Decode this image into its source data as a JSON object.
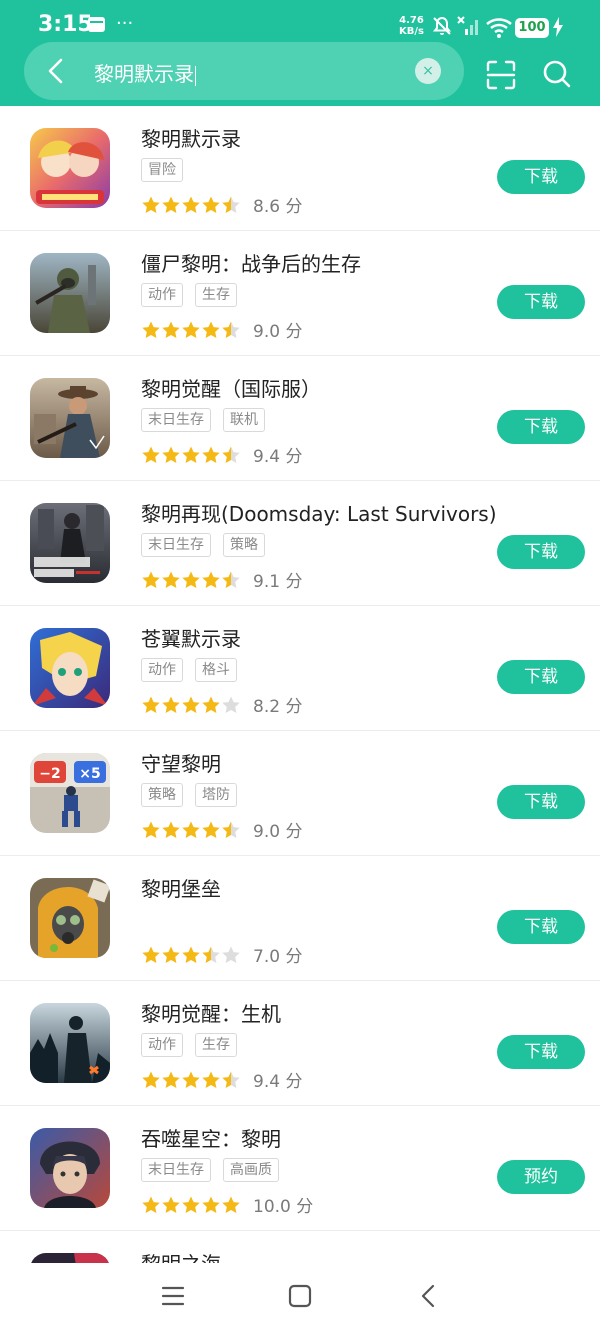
{
  "status": {
    "time": "3:15",
    "dots": "···",
    "speed_value": "4.76",
    "speed_unit": "KB/s",
    "battery": "100"
  },
  "search": {
    "query": "黎明默示录",
    "clear_icon": "×"
  },
  "colors": {
    "accent": "#20c29d",
    "star": "#f5b915",
    "star_empty": "#dddddd"
  },
  "apps": [
    {
      "name": "黎明默示录",
      "tags": [
        "冒险"
      ],
      "stars": 4.5,
      "score": "8.6 分",
      "action": "下载"
    },
    {
      "name": "僵尸黎明：战争后的生存",
      "tags": [
        "动作",
        "生存"
      ],
      "stars": 4.5,
      "score": "9.0 分",
      "action": "下载"
    },
    {
      "name": "黎明觉醒（国际服）",
      "tags": [
        "末日生存",
        "联机"
      ],
      "stars": 4.5,
      "score": "9.4 分",
      "action": "下载"
    },
    {
      "name": "黎明再现(Doomsday: Last Survivors)",
      "tags": [
        "末日生存",
        "策略"
      ],
      "stars": 4.5,
      "score": "9.1 分",
      "action": "下载"
    },
    {
      "name": "苍翼默示录",
      "tags": [
        "动作",
        "格斗"
      ],
      "stars": 4,
      "score": "8.2 分",
      "action": "下载"
    },
    {
      "name": "守望黎明",
      "tags": [
        "策略",
        "塔防"
      ],
      "stars": 4.5,
      "score": "9.0 分",
      "action": "下载"
    },
    {
      "name": "黎明堡垒",
      "tags": [],
      "stars": 3.5,
      "score": "7.0 分",
      "action": "下载"
    },
    {
      "name": "黎明觉醒：生机",
      "tags": [
        "动作",
        "生存"
      ],
      "stars": 4.5,
      "score": "9.4 分",
      "action": "下载"
    },
    {
      "name": "吞噬星空：黎明",
      "tags": [
        "末日生存",
        "高画质"
      ],
      "stars": 5,
      "score": "10.0 分",
      "action": "预约"
    }
  ],
  "partial_app": {
    "name": "黎明之海"
  },
  "icons": {
    "back": "chevron-left-icon",
    "scan": "scan-icon",
    "search": "search-icon",
    "nav_menu": "menu-icon",
    "nav_home": "home-square-icon",
    "nav_back": "back-triangle-icon"
  }
}
